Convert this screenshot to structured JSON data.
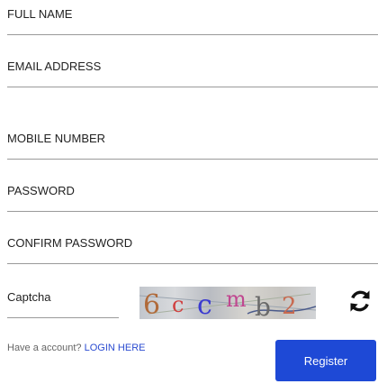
{
  "form": {
    "full_name_placeholder": "FULL NAME",
    "email_placeholder": "EMAIL ADDRESS",
    "mobile_placeholder": "MOBILE NUMBER",
    "password_placeholder": "PASSWORD",
    "confirm_password_placeholder": "CONFIRM PASSWORD",
    "captcha_placeholder": "Captcha",
    "captcha_image_text": "6ccmb2",
    "refresh_icon": "refresh-icon",
    "have_account_text": "Have a account?",
    "login_link": "LOGIN HERE",
    "register_label": "Register"
  },
  "colors": {
    "accent": "#1e49d6",
    "link": "#2a4bd1"
  }
}
